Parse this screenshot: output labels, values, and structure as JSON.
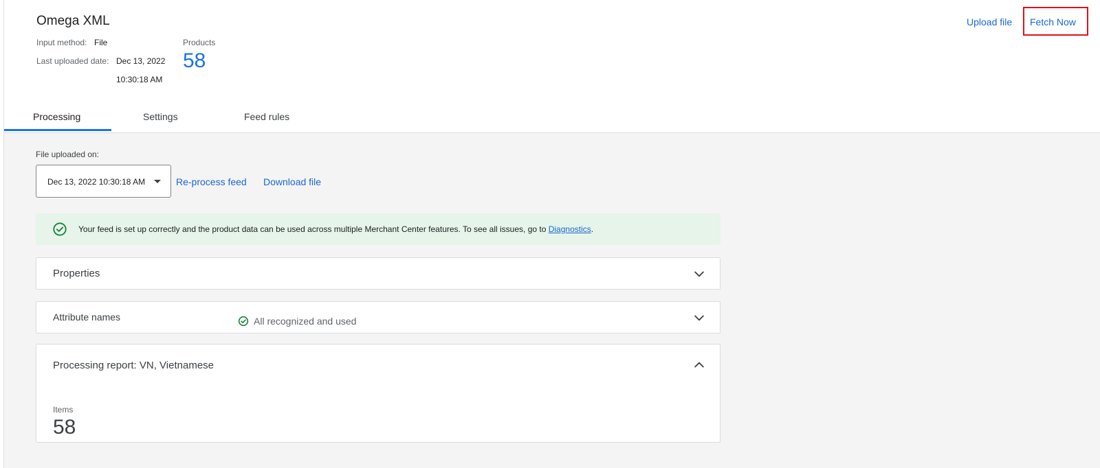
{
  "header": {
    "title": "Omega XML",
    "input_method_label": "Input method:",
    "input_method_value": "File",
    "last_uploaded_label": "Last uploaded date:",
    "last_uploaded_date": "Dec 13, 2022",
    "last_uploaded_time": "10:30:18 AM",
    "products_label": "Products",
    "products_count": "58",
    "upload_file_label": "Upload file",
    "fetch_now_label": "Fetch Now"
  },
  "tabs": [
    {
      "label": "Processing",
      "active": true
    },
    {
      "label": "Settings",
      "active": false
    },
    {
      "label": "Feed rules",
      "active": false
    }
  ],
  "processing": {
    "file_uploaded_label": "File uploaded on:",
    "selected_upload": "Dec 13, 2022 10:30:18 AM",
    "reprocess_label": "Re-process feed",
    "download_label": "Download file",
    "banner_text": "Your feed is set up correctly and the product data can be used across multiple Merchant Center features. To see all issues, go to ",
    "banner_link": "Diagnostics",
    "banner_end": ".",
    "properties_title": "Properties",
    "attribute_names_title": "Attribute names",
    "attribute_status": "All recognized and used",
    "report_title": "Processing report: VN, Vietnamese",
    "items_label": "Items",
    "items_value": "58"
  },
  "colors": {
    "accent": "#1a73e8",
    "link": "#1967d2",
    "success": "#188038",
    "success_bg": "#e6f4ea",
    "highlight_box": "#e0101b"
  },
  "icons": {
    "banner": "check-circle-icon",
    "status": "check-circle-icon",
    "expand": "chevron-down-icon",
    "collapse": "chevron-up-icon",
    "dropdown": "caret-down-icon"
  }
}
